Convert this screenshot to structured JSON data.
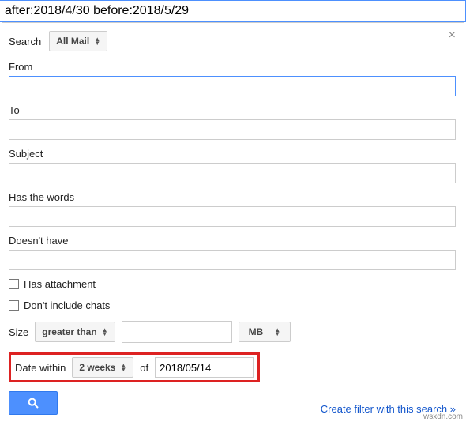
{
  "searchBar": {
    "value": "after:2018/4/30 before:2018/5/29"
  },
  "close": "×",
  "searchScope": {
    "label": "Search",
    "selected": "All Mail"
  },
  "fields": {
    "from": {
      "label": "From",
      "value": ""
    },
    "to": {
      "label": "To",
      "value": ""
    },
    "subject": {
      "label": "Subject",
      "value": ""
    },
    "hasWords": {
      "label": "Has the words",
      "value": ""
    },
    "doesntHave": {
      "label": "Doesn't have",
      "value": ""
    }
  },
  "checkboxes": {
    "hasAttachment": {
      "label": "Has attachment",
      "checked": false
    },
    "dontIncludeChats": {
      "label": "Don't include chats",
      "checked": false
    }
  },
  "size": {
    "label": "Size",
    "operator": "greater than",
    "value": "",
    "unit": "MB"
  },
  "date": {
    "label": "Date within",
    "range": "2 weeks",
    "ofLabel": "of",
    "value": "2018/05/14"
  },
  "actions": {
    "createFilter": "Create filter with this search »"
  },
  "watermark": "wsxdn.com",
  "chart_data": null
}
